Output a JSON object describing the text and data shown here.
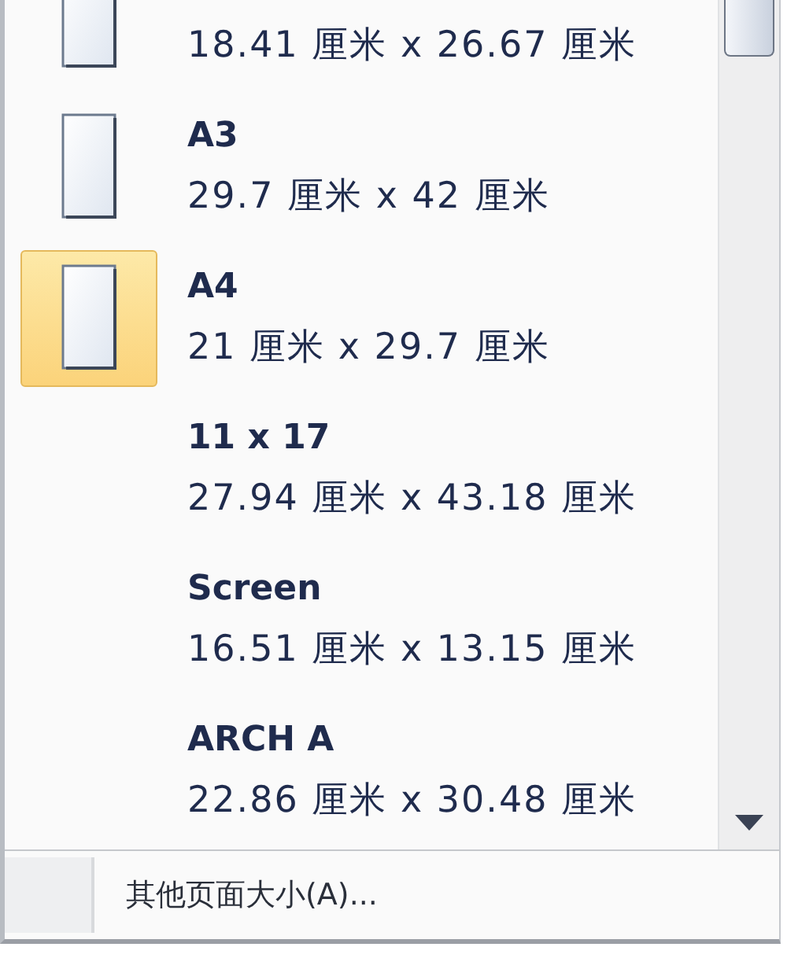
{
  "sizes": [
    {
      "dimensions": "18.41 厘米 x 26.67 厘米",
      "icon": true,
      "selected": false
    },
    {
      "name": "A3",
      "dimensions": "29.7 厘米 x 42 厘米",
      "icon": true,
      "selected": false
    },
    {
      "name": "A4",
      "dimensions": "21 厘米 x 29.7 厘米",
      "icon": true,
      "selected": true
    },
    {
      "name": "11 x 17",
      "dimensions": "27.94 厘米 x 43.18 厘米",
      "icon": false,
      "selected": false
    },
    {
      "name": "Screen",
      "dimensions": "16.51 厘米 x 13.15 厘米",
      "icon": false,
      "selected": false
    },
    {
      "name": "ARCH A",
      "dimensions": "22.86 厘米 x 30.48 厘米",
      "icon": false,
      "selected": false
    }
  ],
  "footer": {
    "label": "其他页面大小(A)..."
  }
}
